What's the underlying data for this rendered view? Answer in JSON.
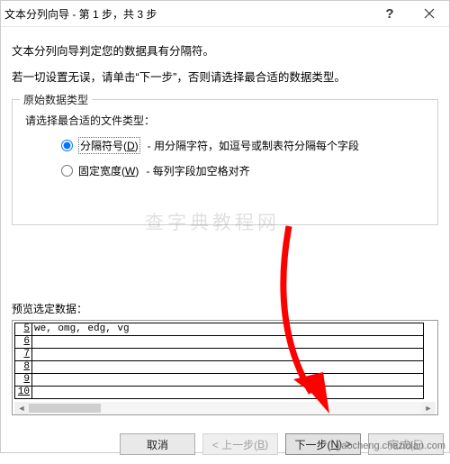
{
  "window": {
    "title": "文本分列向导 - 第 1 步，共 3 步"
  },
  "intro": {
    "line1": "文本分列向导判定您的数据具有分隔符。",
    "line2": "若一切设置无误，请单击“下一步”，否则请选择最合适的数据类型。"
  },
  "group": {
    "legend": "原始数据类型",
    "prompt": "请选择最合适的文件类型：",
    "options": [
      {
        "label_pre": "分隔符号(",
        "mnemonic": "D",
        "label_post": ")",
        "desc": "- 用分隔字符，如逗号或制表符分隔每个字段",
        "checked": true
      },
      {
        "label_pre": "固定宽度(",
        "mnemonic": "W",
        "label_post": ")",
        "desc": "- 每列字段加空格对齐",
        "checked": false
      }
    ]
  },
  "preview": {
    "label": "预览选定数据：",
    "rows": [
      {
        "num": "5",
        "text": "we, omg, edg, vg"
      },
      {
        "num": "6",
        "text": ""
      },
      {
        "num": "7",
        "text": ""
      },
      {
        "num": "8",
        "text": ""
      },
      {
        "num": "9",
        "text": ""
      },
      {
        "num": "10",
        "text": ""
      }
    ]
  },
  "buttons": {
    "cancel": "取消",
    "back_pre": "< 上一步(",
    "back_mn": "B",
    "back_post": ")",
    "next_pre": "下一步(",
    "next_mn": "N",
    "next_post": ") >",
    "finish_pre": "完成(",
    "finish_mn": "F",
    "finish_post": ")"
  },
  "marks": {
    "watermark": "查字典教程网",
    "footer": "jiaocheng.chazidian.com"
  }
}
